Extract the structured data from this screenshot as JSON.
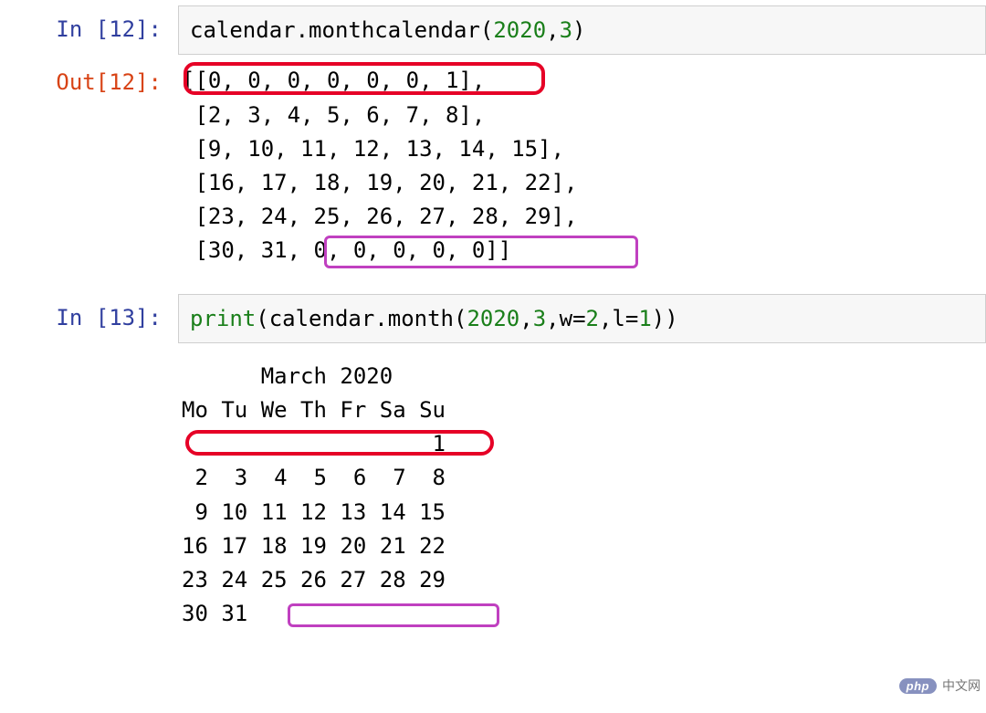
{
  "cells": [
    {
      "prompt_in": "In [12]:",
      "prompt_num": "12",
      "code_tokens": {
        "t1": "calendar",
        "t2": ".",
        "t3": "monthcalendar",
        "t4": "(",
        "t5": "2020",
        "t6": ",",
        "t7": "3",
        "t8": ")"
      },
      "prompt_out": "Out[12]:",
      "output_lines": [
        "[[0, 0, 0, 0, 0, 0, 1],",
        " [2, 3, 4, 5, 6, 7, 8],",
        " [9, 10, 11, 12, 13, 14, 15],",
        " [16, 17, 18, 19, 20, 21, 22],",
        " [23, 24, 25, 26, 27, 28, 29],",
        " [30, 31, 0, 0, 0, 0, 0]]"
      ]
    },
    {
      "prompt_in": "In [13]:",
      "prompt_num": "13",
      "code_tokens": {
        "t1": "print",
        "t2": "(",
        "t3": "calendar",
        "t4": ".",
        "t5": "month",
        "t6": "(",
        "t7": "2020",
        "t8": ",",
        "t9": "3",
        "t10": ",",
        "t11": "w",
        "t12": "=",
        "t13": "2",
        "t14": ",",
        "t15": "l",
        "t16": "=",
        "t17": "1",
        "t18": ")",
        "t19": ")"
      },
      "output_lines": [
        "      March 2020",
        "Mo Tu We Th Fr Sa Su",
        "                   1",
        " 2  3  4  5  6  7  8",
        " 9 10 11 12 13 14 15",
        "16 17 18 19 20 21 22",
        "23 24 25 26 27 28 29",
        "30 31"
      ]
    }
  ],
  "chart_data": {
    "type": "table",
    "title": "March 2020",
    "headers": [
      "Mo",
      "Tu",
      "We",
      "Th",
      "Fr",
      "Sa",
      "Su"
    ],
    "rows": [
      [
        0,
        0,
        0,
        0,
        0,
        0,
        1
      ],
      [
        2,
        3,
        4,
        5,
        6,
        7,
        8
      ],
      [
        9,
        10,
        11,
        12,
        13,
        14,
        15
      ],
      [
        16,
        17,
        18,
        19,
        20,
        21,
        22
      ],
      [
        23,
        24,
        25,
        26,
        27,
        28,
        29
      ],
      [
        30,
        31,
        0,
        0,
        0,
        0,
        0
      ]
    ],
    "highlights": [
      {
        "color": "#e60026",
        "label": "leading-zeros-week1",
        "cells": "row0 cols0-5"
      },
      {
        "color": "#c040c0",
        "label": "trailing-zeros-week6",
        "cells": "row5 cols2-6"
      }
    ]
  },
  "watermark": {
    "logo": "php",
    "text": "中文网"
  }
}
